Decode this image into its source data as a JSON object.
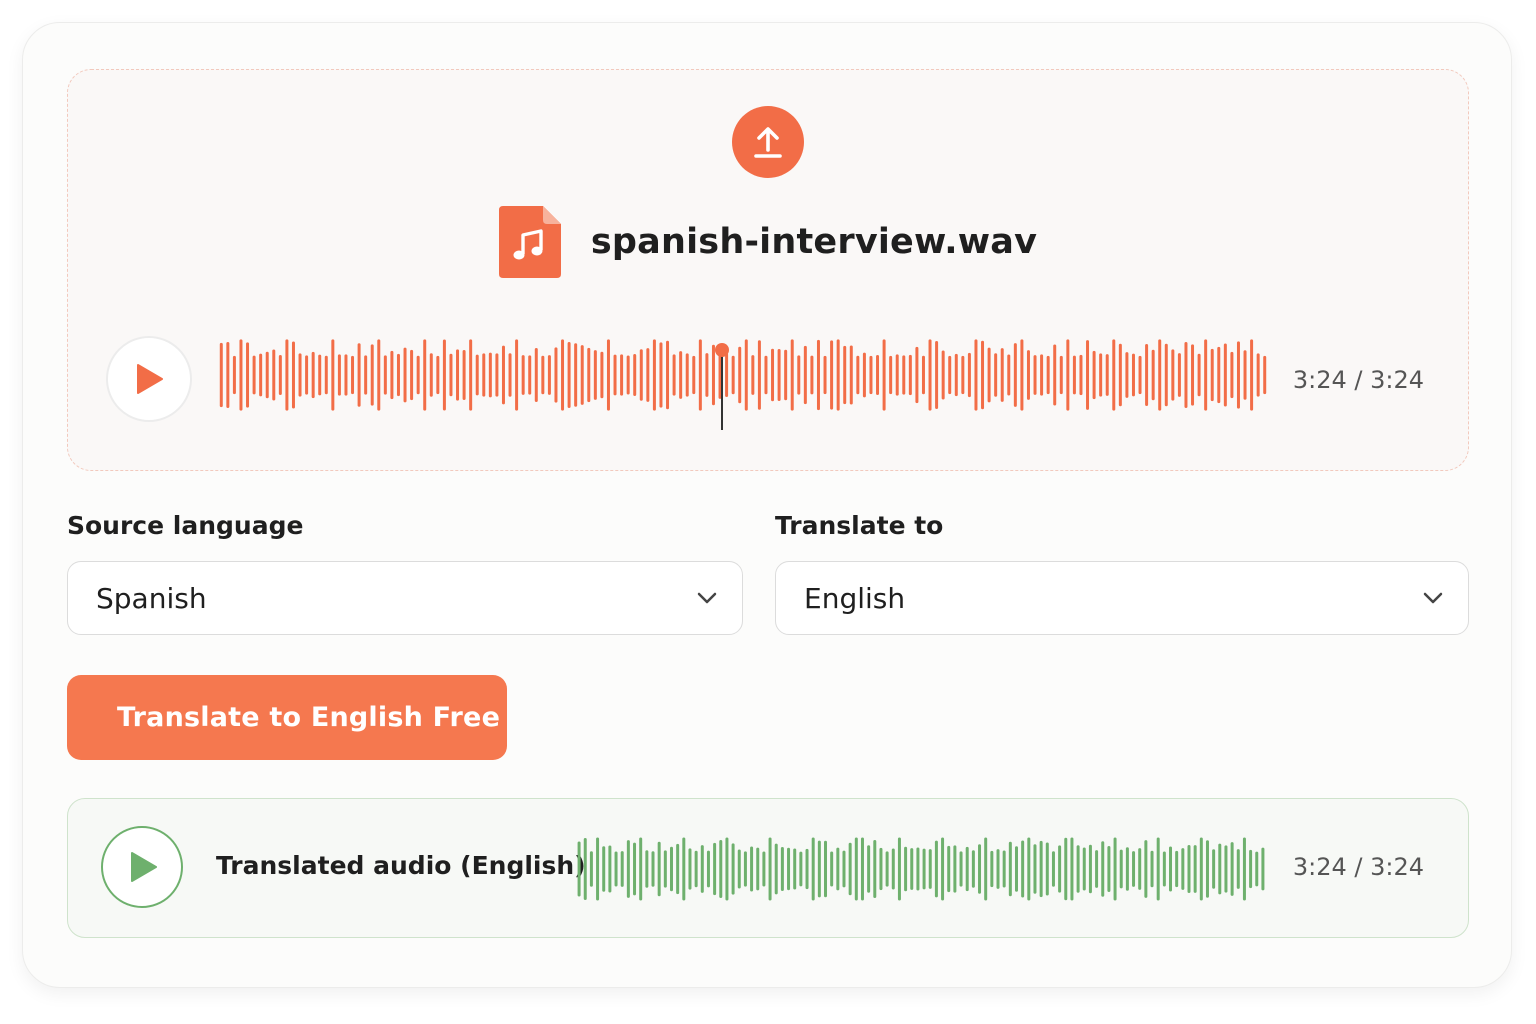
{
  "upload": {
    "file_name": "spanish-interview.wav",
    "upload_icon": "upload-arrow-icon",
    "file_icon": "audio-file-icon",
    "time_display": "3:24 / 3:24",
    "playback_progress": 0.48,
    "accent_color": "#f26d47"
  },
  "source": {
    "label": "Source language",
    "value": "Spanish"
  },
  "target": {
    "label": "Translate to",
    "value": "English"
  },
  "action": {
    "label": "Translate to English Free",
    "color": "#f5784f"
  },
  "result": {
    "label": "Translated audio (English)",
    "time_display": "3:24 / 3:24",
    "accent_color": "#6eb06d"
  }
}
